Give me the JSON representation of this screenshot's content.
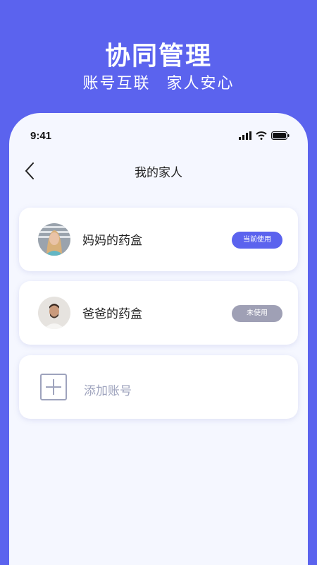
{
  "hero": {
    "title": "协同管理",
    "subtitle": "账号互联  家人安心"
  },
  "status_bar": {
    "time": "9:41",
    "icons": [
      "signal-icon",
      "wifi-icon",
      "battery-icon"
    ]
  },
  "nav": {
    "title": "我的家人",
    "back_icon": "chevron-left-icon"
  },
  "accounts": [
    {
      "label": "妈妈的药盒",
      "badge": "当前使用",
      "badge_color": "#5b63ee",
      "avatar": "female-avatar"
    },
    {
      "label": "爸爸的药盒",
      "badge": "未使用",
      "badge_color": "#9fa0b5",
      "avatar": "male-avatar"
    }
  ],
  "add_account": {
    "label": "添加账号",
    "icon": "plus-square-icon"
  },
  "colors": {
    "accent": "#5b63ee",
    "background": "#f5f7ff",
    "muted": "#9ea3bd"
  }
}
